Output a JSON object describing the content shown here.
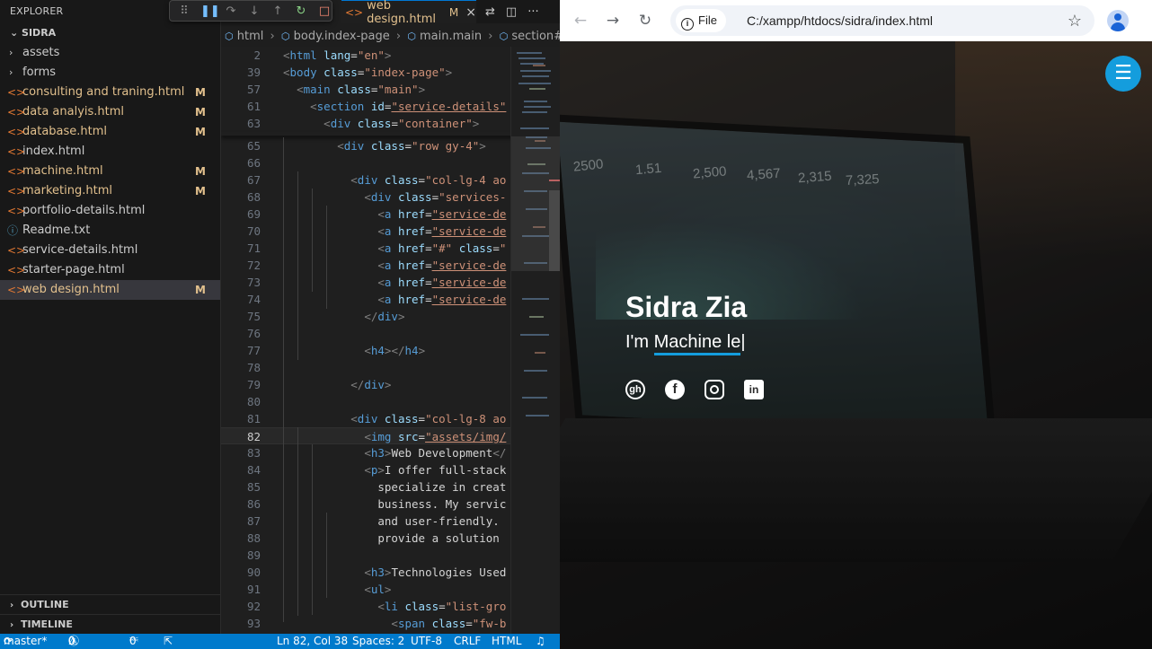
{
  "vscode": {
    "explorer": {
      "title": "EXPLORER",
      "project": "SIDRA",
      "items": [
        {
          "label": "assets",
          "kind": "folder",
          "status": ""
        },
        {
          "label": "forms",
          "kind": "folder",
          "status": ""
        },
        {
          "label": "consulting and traning.html",
          "kind": "html",
          "status": "M"
        },
        {
          "label": "data analyis.html",
          "kind": "html",
          "status": "M"
        },
        {
          "label": "database.html",
          "kind": "html",
          "status": "M"
        },
        {
          "label": "index.html",
          "kind": "html",
          "status": ""
        },
        {
          "label": "machine.html",
          "kind": "html",
          "status": "M"
        },
        {
          "label": "marketing.html",
          "kind": "html",
          "status": "M"
        },
        {
          "label": "portfolio-details.html",
          "kind": "html",
          "status": ""
        },
        {
          "label": "Readme.txt",
          "kind": "txt",
          "status": ""
        },
        {
          "label": "service-details.html",
          "kind": "html",
          "status": ""
        },
        {
          "label": "starter-page.html",
          "kind": "html",
          "status": ""
        },
        {
          "label": "web design.html",
          "kind": "html",
          "status": "M"
        }
      ],
      "outline_label": "OUTLINE",
      "timeline_label": "TIMELINE"
    },
    "tab": {
      "label": "web design.html",
      "status": "M"
    },
    "breadcrumb": [
      "html",
      "body.index-page",
      "main.main",
      "section#sen"
    ],
    "sticky_lines": [
      {
        "n": "2",
        "text": "<html lang=\"en\">"
      },
      {
        "n": "39",
        "text": "<body class=\"index-page\">"
      },
      {
        "n": "57",
        "text": "  <main class=\"main\">"
      },
      {
        "n": "61",
        "text": "    <section id=\"service-details\""
      },
      {
        "n": "63",
        "text": "      <div class=\"container\">"
      }
    ],
    "code_lines": [
      {
        "n": "65",
        "text": "        <div class=\"row gy-4\">"
      },
      {
        "n": "66",
        "text": ""
      },
      {
        "n": "67",
        "text": "          <div class=\"col-lg-4 ao"
      },
      {
        "n": "68",
        "text": "            <div class=\"services-"
      },
      {
        "n": "69",
        "text": "              <a href=\"service-de"
      },
      {
        "n": "70",
        "text": "              <a href=\"service-de"
      },
      {
        "n": "71",
        "text": "              <a href=\"#\" class=\""
      },
      {
        "n": "72",
        "text": "              <a href=\"service-de"
      },
      {
        "n": "73",
        "text": "              <a href=\"service-de"
      },
      {
        "n": "74",
        "text": "              <a href=\"service-de"
      },
      {
        "n": "75",
        "text": "            </div>"
      },
      {
        "n": "76",
        "text": ""
      },
      {
        "n": "77",
        "text": "            <h4></h4>"
      },
      {
        "n": "78",
        "text": ""
      },
      {
        "n": "79",
        "text": "          </div>"
      },
      {
        "n": "80",
        "text": ""
      },
      {
        "n": "81",
        "text": "          <div class=\"col-lg-8 ao"
      },
      {
        "n": "82",
        "text": "            <img src=\"assets/img/"
      },
      {
        "n": "83",
        "text": "            <h3>Web Development</"
      },
      {
        "n": "84",
        "text": "            <p>I offer full-stack"
      },
      {
        "n": "85",
        "text": "              specialize in creat"
      },
      {
        "n": "86",
        "text": "              business. My servic"
      },
      {
        "n": "87",
        "text": "              and user-friendly."
      },
      {
        "n": "88",
        "text": "              provide a solution"
      },
      {
        "n": "89",
        "text": ""
      },
      {
        "n": "90",
        "text": "            <h3>Technologies Used"
      },
      {
        "n": "91",
        "text": "            <ul>"
      },
      {
        "n": "92",
        "text": "              <li class=\"list-gro"
      },
      {
        "n": "93",
        "text": "                <span class=\"fw-b"
      }
    ],
    "current_line": "82",
    "status": {
      "branch": "master*",
      "errors": "0",
      "warnings": "0",
      "ports": "0",
      "position": "Ln 82, Col 38",
      "spaces": "Spaces: 2",
      "encoding": "UTF-8",
      "eol": "CRLF",
      "language": "HTML"
    }
  },
  "browser": {
    "chip_label": "File",
    "url": "C:/xampp/htdocs/sidra/index.html",
    "hero": {
      "name": "Sidra Zia",
      "prefix": "I'm ",
      "typed": "Machine le",
      "socials": [
        "github-icon",
        "facebook-icon",
        "instagram-icon",
        "linkedin-icon"
      ]
    },
    "screen_numbers": [
      "2500",
      "1.51",
      "2,500",
      "4,567",
      "2,315",
      "7,325"
    ],
    "colors": {
      "accent": "#149ddd",
      "statusbar": "#007acc",
      "modified": "#e2c08d"
    }
  }
}
